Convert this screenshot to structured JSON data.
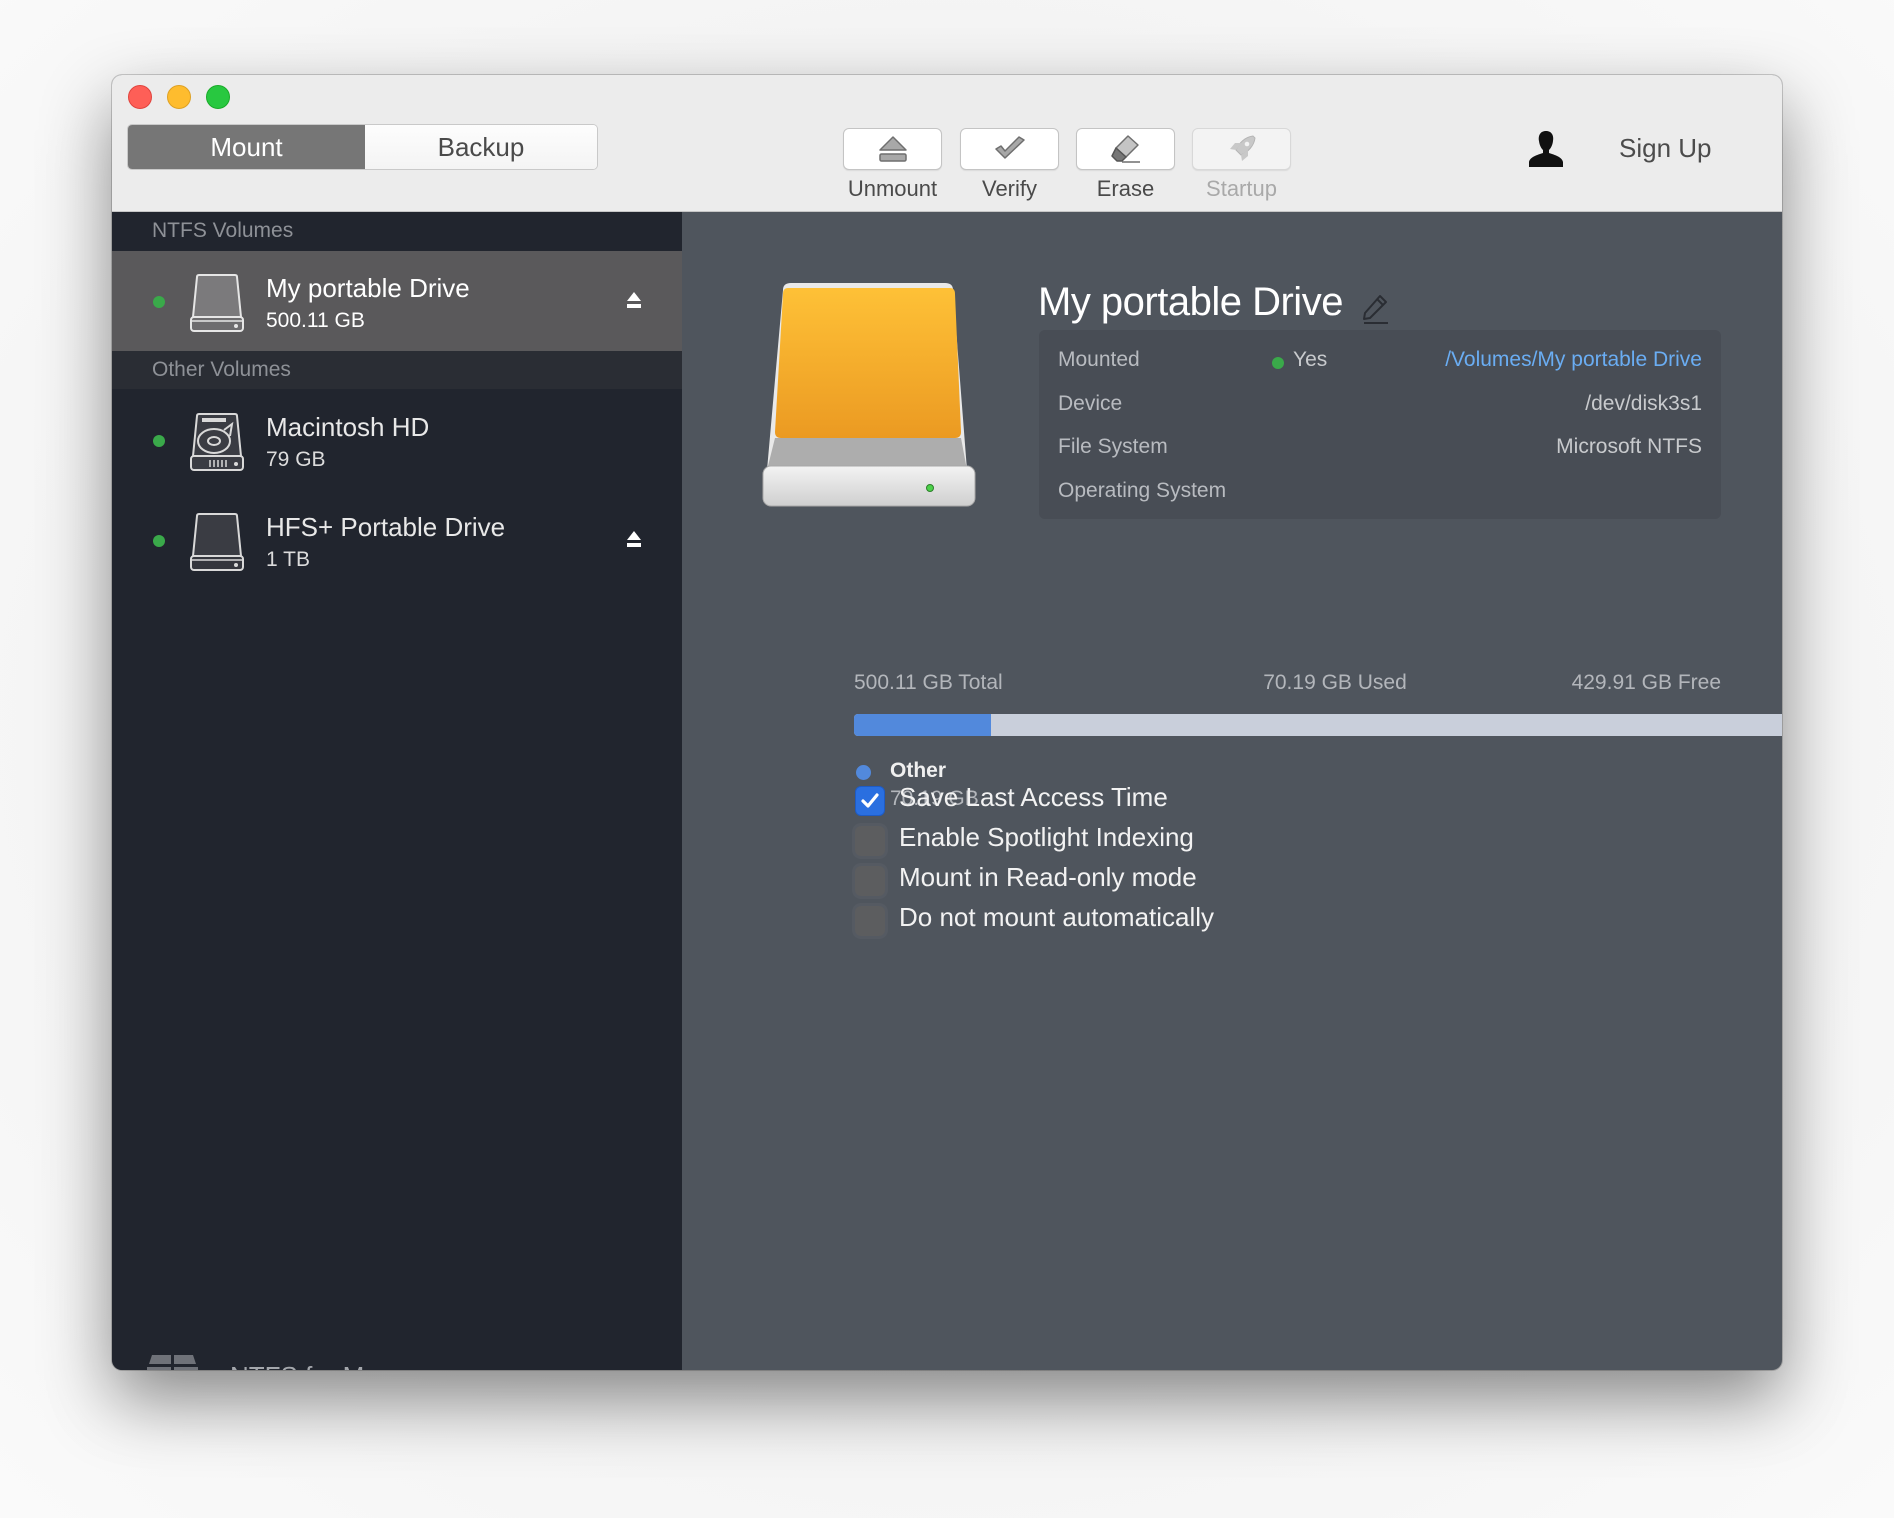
{
  "window": {
    "traffic_lights": [
      "close",
      "minimize",
      "zoom"
    ]
  },
  "toolbar": {
    "segments": [
      {
        "label": "Mount",
        "selected": true
      },
      {
        "label": "Backup",
        "selected": false
      }
    ],
    "actions": [
      {
        "label": "Unmount",
        "icon": "eject-icon",
        "enabled": true
      },
      {
        "label": "Verify",
        "icon": "checkmark-icon",
        "enabled": true
      },
      {
        "label": "Erase",
        "icon": "eraser-icon",
        "enabled": true
      },
      {
        "label": "Startup",
        "icon": "rocket-icon",
        "enabled": false
      }
    ],
    "account_icon": "user-icon",
    "sign_up_label": "Sign Up"
  },
  "sidebar": {
    "sections": [
      {
        "title": "NTFS Volumes",
        "volumes": [
          {
            "name": "My portable Drive",
            "size": "500.11 GB",
            "mounted": true,
            "ejectable": true,
            "selected": true,
            "icon": "external-drive-icon"
          }
        ]
      },
      {
        "title": "Other Volumes",
        "volumes": [
          {
            "name": "Macintosh HD",
            "size": "79 GB",
            "mounted": true,
            "ejectable": false,
            "selected": false,
            "icon": "internal-disk-icon"
          },
          {
            "name": "HFS+ Portable Drive",
            "size": "1 TB",
            "mounted": true,
            "ejectable": true,
            "selected": false,
            "icon": "external-drive-icon"
          }
        ]
      }
    ],
    "footer": {
      "app_name": "NTFS for Mac",
      "logo": "ntfs-app-logo-icon"
    }
  },
  "detail": {
    "title": "My portable Drive",
    "info": {
      "mounted_label": "Mounted",
      "mounted_status": "Yes",
      "mount_path": "/Volumes/My portable Drive",
      "device_label": "Device",
      "device_value": "/dev/disk3s1",
      "filesystem_label": "File System",
      "filesystem_value": "Microsoft NTFS",
      "os_label": "Operating System",
      "os_value": ""
    },
    "storage": {
      "total_label": "500.11 GB Total",
      "used_label": "70.19 GB Used",
      "free_label": "429.91 GB Free",
      "used_fraction": 0.1404,
      "used_color": "#5289dc",
      "free_color": "#c9cfdb",
      "legend": [
        {
          "name": "Other",
          "value": "70.19 GB",
          "color": "#5289dc"
        }
      ]
    },
    "options": [
      {
        "label": "Save Last Access Time",
        "checked": true
      },
      {
        "label": "Enable Spotlight Indexing",
        "checked": false
      },
      {
        "label": "Mount in Read-only mode",
        "checked": false
      },
      {
        "label": "Do not mount automatically",
        "checked": false
      }
    ]
  }
}
